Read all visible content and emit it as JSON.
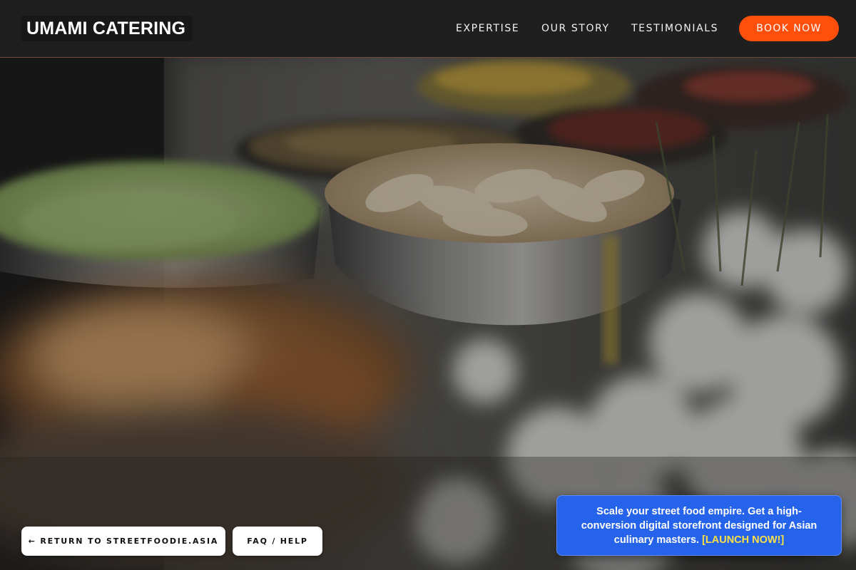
{
  "header": {
    "brand": "UMAMI CATERING",
    "nav": [
      {
        "label": "EXPERTISE"
      },
      {
        "label": "OUR STORY"
      },
      {
        "label": "TESTIMONIALS"
      }
    ],
    "cta_label": "BOOK NOW"
  },
  "hero": {
    "image_icon": "catering-buffet-photo"
  },
  "footer_buttons": {
    "return_label": "← RETURN TO STREETFOODIE.ASIA",
    "faq_label": "FAQ / HELP"
  },
  "promo": {
    "text": "Scale your street food empire. Get a high-conversion digital storefront designed for Asian culinary masters.",
    "cta": "[LAUNCH NOW!]"
  },
  "colors": {
    "accent": "#ff4f0a",
    "promo_bg": "#2563eb",
    "promo_cta": "#fde047",
    "header_bg": "#1f1f1f"
  }
}
